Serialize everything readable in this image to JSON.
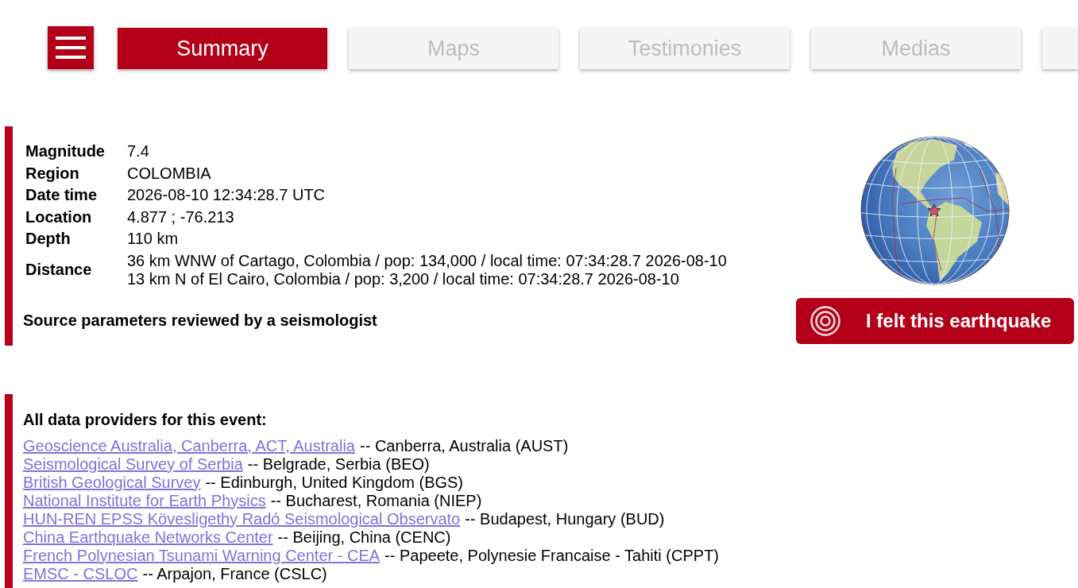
{
  "tabs": [
    {
      "label": "Summary",
      "selected": true
    },
    {
      "label": "Maps",
      "selected": false
    },
    {
      "label": "Testimonies",
      "selected": false
    },
    {
      "label": "Medias",
      "selected": false
    },
    {
      "selected": false
    }
  ],
  "event": {
    "fields": [
      {
        "label": "Magnitude",
        "values": [
          "7.4"
        ]
      },
      {
        "label": "Region",
        "values": [
          "COLOMBIA"
        ]
      },
      {
        "label": "Date time",
        "values": [
          "2026-08-10 12:34:28.7 UTC"
        ]
      },
      {
        "label": "Location",
        "values": [
          "4.877 ; -76.213"
        ]
      },
      {
        "label": "Depth",
        "values": [
          "110 km"
        ]
      },
      {
        "label": "Distance",
        "values": [
          "36 km WNW of Cartago, Colombia / pop: 134,000 / local time: 07:34:28.7 2026-08-10",
          "13 km N of El Cairo, Colombia / pop: 3,200 / local time: 07:34:28.7 2026-08-10"
        ]
      }
    ],
    "review_note": "Source parameters reviewed by a seismologist"
  },
  "felt_button": {
    "label": "I felt this earthquake"
  },
  "providers": {
    "heading": "All data providers for this event:",
    "items": [
      {
        "name": "Geoscience Australia, Canberra, ACT, Australia",
        "detail": "-- Canberra, Australia (AUST)"
      },
      {
        "name": "Seismological Survey of Serbia",
        "detail": "-- Belgrade, Serbia (BEO)"
      },
      {
        "name": "British Geological Survey",
        "detail": "-- Edinburgh, United Kingdom (BGS)"
      },
      {
        "name": "National Institute for Earth Physics",
        "detail": "-- Bucharest, Romania (NIEP)"
      },
      {
        "name": "HUN-REN EPSS Kövesligethy Radó Seismological Observato",
        "detail": "-- Budapest, Hungary (BUD)"
      },
      {
        "name": "China Earthquake Networks Center",
        "detail": "-- Beijing, China (CENC)"
      },
      {
        "name": "French Polynesian Tsunami Warning Center - CEA",
        "detail": "-- Papeete, Polynesie Francaise - Tahiti (CPPT)"
      },
      {
        "name": "EMSC - CSLOC",
        "detail": "-- Arpajon, France (CSLC)"
      }
    ]
  }
}
